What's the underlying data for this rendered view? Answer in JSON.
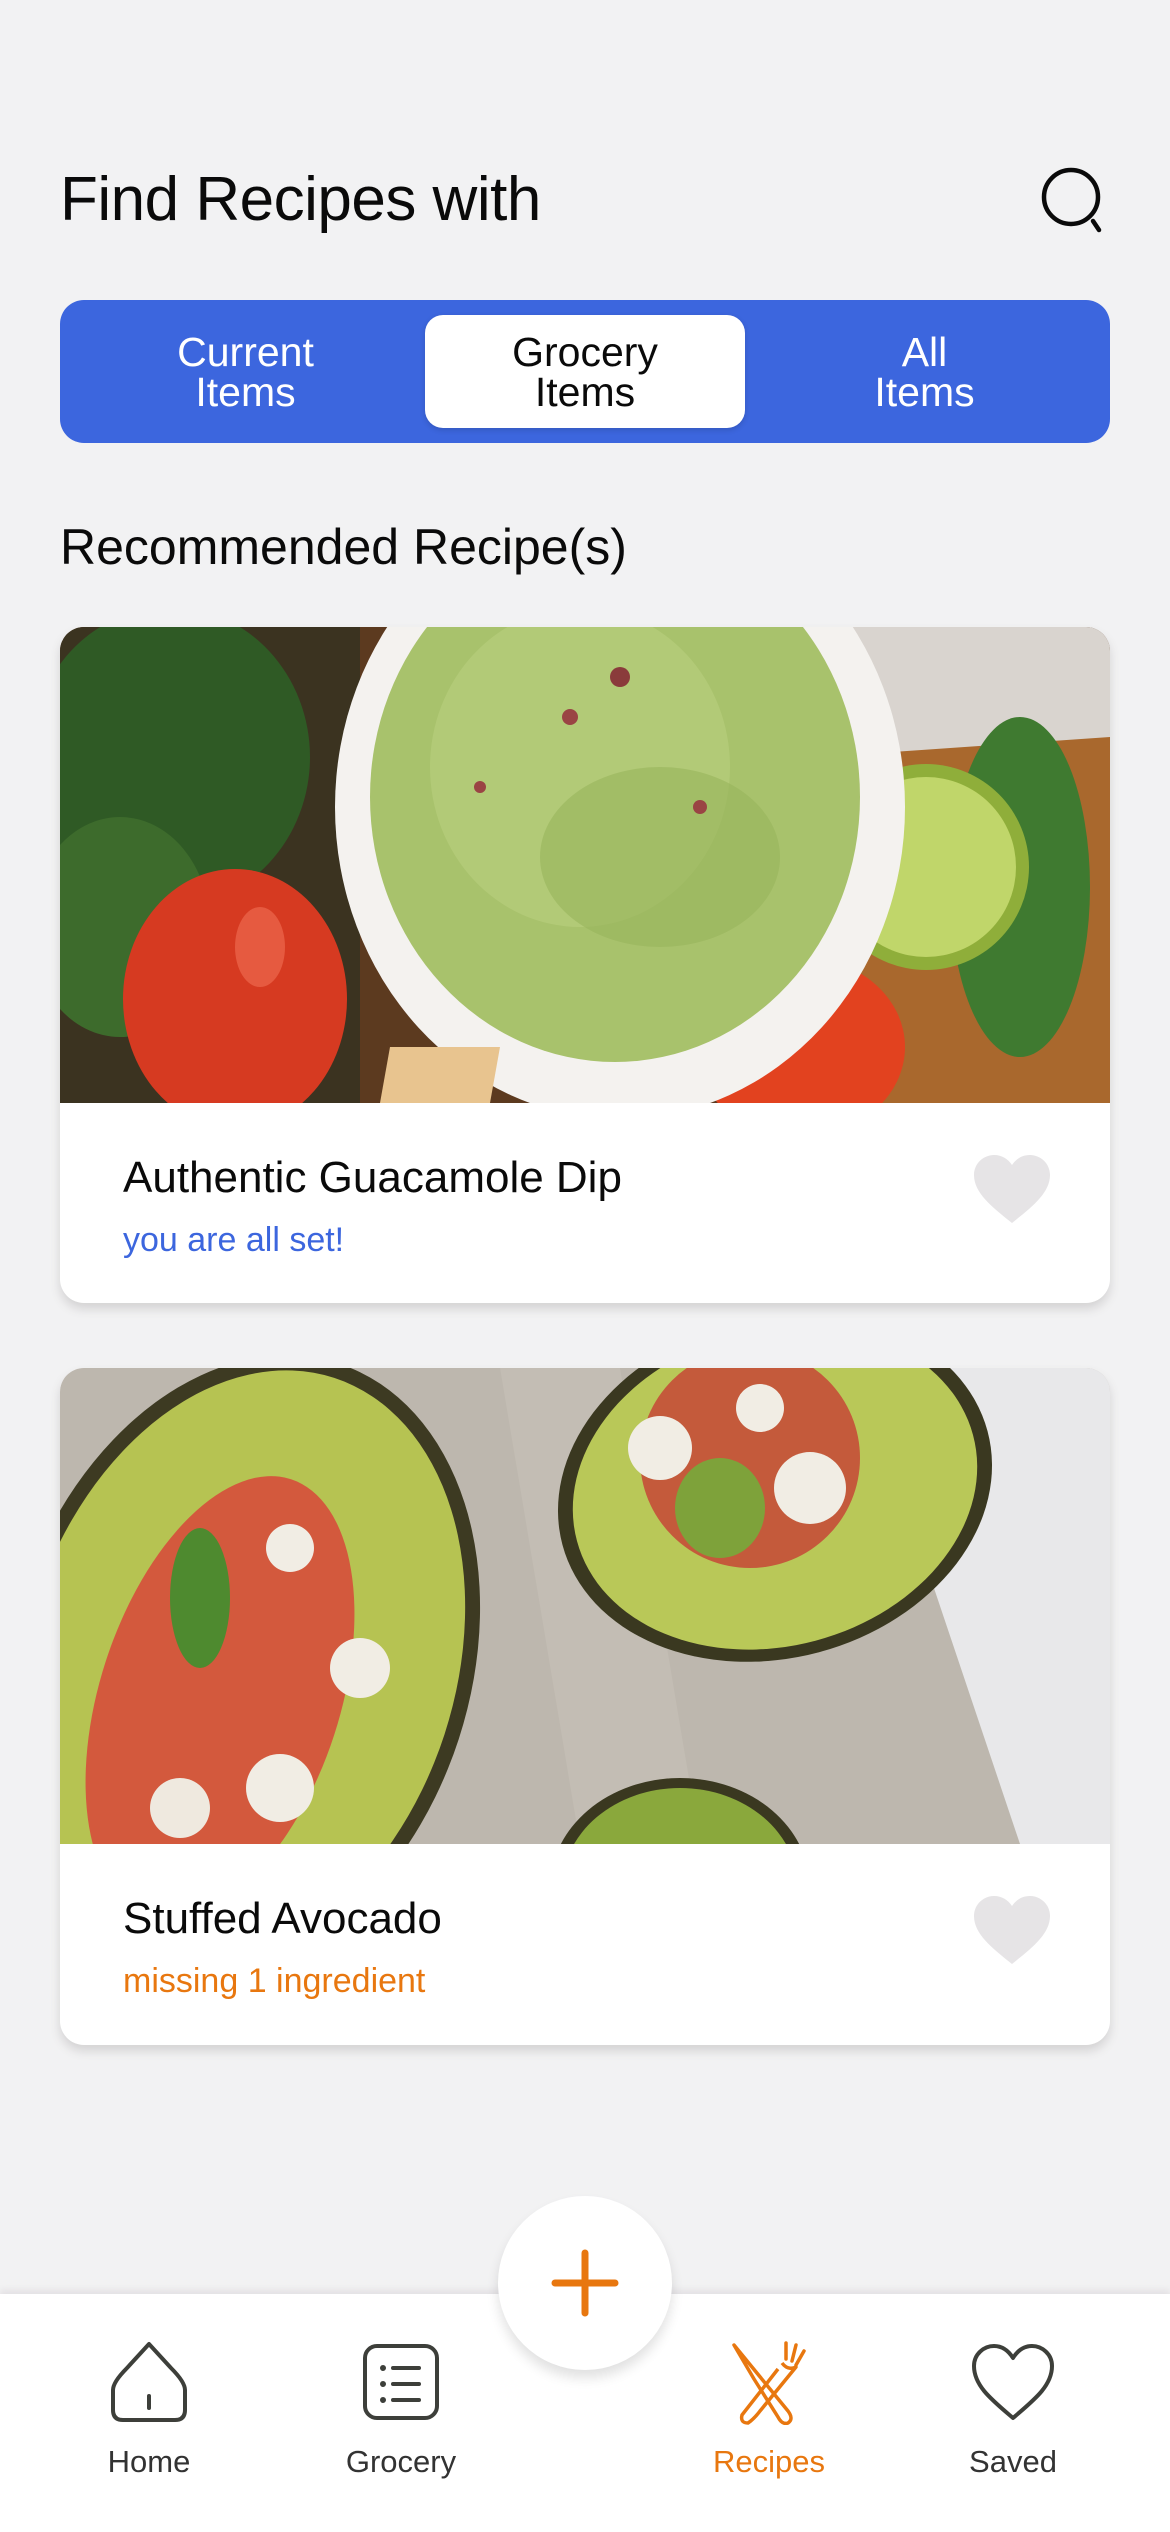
{
  "header": {
    "title": "Find Recipes with",
    "search_icon": "search-icon"
  },
  "filter": {
    "options": [
      {
        "line1": "Current",
        "line2": "Items",
        "selected": false
      },
      {
        "line1": "Grocery",
        "line2": "Items",
        "selected": true
      },
      {
        "line1": "All",
        "line2": "Items",
        "selected": false
      }
    ]
  },
  "section": {
    "title": "Recommended Recipe(s)"
  },
  "recipes": [
    {
      "title": "Authentic Guacamole Dip",
      "status": "you are all set!",
      "status_color": "#3c66de",
      "image": "guacamole-photo",
      "favorite_icon": "heart-icon",
      "favorited": false
    },
    {
      "title": "Stuffed Avocado",
      "status": "missing 1 ingredient",
      "status_color": "#e8770f",
      "image": "stuffed-avocado-photo",
      "favorite_icon": "heart-icon",
      "favorited": false
    }
  ],
  "fab": {
    "icon": "plus-icon"
  },
  "tabbar": {
    "items": [
      {
        "label": "Home",
        "icon": "home-icon",
        "active": false
      },
      {
        "label": "Grocery",
        "icon": "list-icon",
        "active": false
      },
      {
        "label": "Recipes",
        "icon": "fork-knife-icon",
        "active": true
      },
      {
        "label": "Saved",
        "icon": "heart-icon",
        "active": false
      }
    ]
  },
  "colors": {
    "primary": "#3c66de",
    "accent": "#e8770f",
    "background": "#f2f2f3",
    "text": "#0a0a0a",
    "icon_inactive": "#3d3f3a",
    "heart_inactive": "#e6e4e6"
  }
}
